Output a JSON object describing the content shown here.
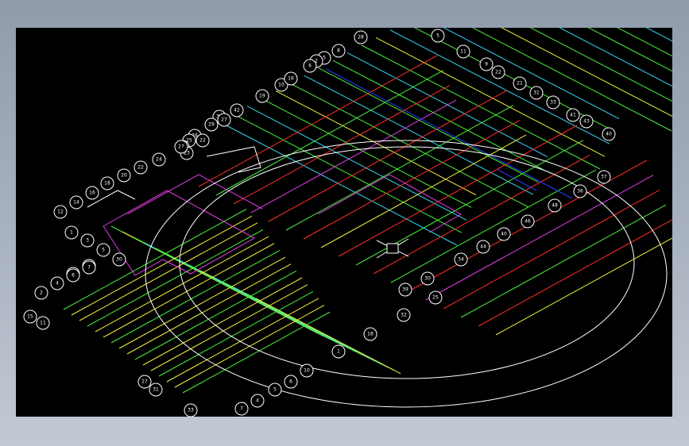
{
  "drawing": {
    "background": "#000000",
    "colors": {
      "red": "#ff2a2a",
      "green": "#48f03a",
      "yellow": "#f0f03a",
      "cyan": "#38d6f0",
      "magenta": "#e23ce6",
      "blue": "#2a3cff",
      "white": "#ffffff"
    },
    "cursor": "crosshair-pickbox-icon",
    "labels": {
      "top_row": [
        "28",
        "5",
        "11",
        "9",
        "22",
        "21",
        "31",
        "33",
        "41",
        "43",
        "40"
      ],
      "top_cluster": [
        "8",
        "5",
        "2",
        "6",
        "10",
        "16",
        "19",
        "42",
        "39",
        "29",
        "26",
        "25",
        "24",
        "23",
        "22",
        "27"
      ],
      "left_column": [
        "12",
        "14",
        "16",
        "18",
        "20",
        "22",
        "24",
        "27",
        "1",
        "3",
        "5",
        "0",
        "8",
        "30",
        "2",
        "4",
        "6",
        "7",
        "15",
        "11"
      ],
      "bottom_row": [
        "27",
        "31",
        "33",
        "7",
        "4",
        "5",
        "6",
        "10",
        "1",
        "18",
        "32",
        "25",
        "30",
        "34",
        "44",
        "40",
        "46",
        "48",
        "36",
        "37",
        "39"
      ]
    }
  }
}
